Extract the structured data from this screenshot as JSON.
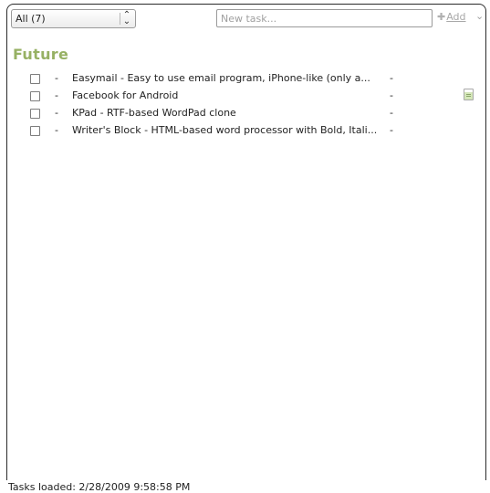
{
  "toolbar": {
    "filter_value": "All (7)",
    "filter_arrow_icon": "updown-arrows-icon",
    "new_task_placeholder": "New task...",
    "new_task_value": "",
    "add_label_prefix": "Add",
    "add_icon": "plus-icon",
    "menu_icon": "chevron-down-icon"
  },
  "section": {
    "title": "Future",
    "color": "#97b164"
  },
  "tasks": [
    {
      "checked": false,
      "dash": "-",
      "title": "Easymail - Easy to use email program, iPhone-like (only a...",
      "date": "-",
      "has_note": false
    },
    {
      "checked": false,
      "dash": "-",
      "title": "Facebook for Android",
      "date": "-",
      "has_note": true
    },
    {
      "checked": false,
      "dash": "-",
      "title": "KPad - RTF-based WordPad clone",
      "date": "-",
      "has_note": false
    },
    {
      "checked": false,
      "dash": "-",
      "title": "Writer's Block - HTML-based word processor with Bold, Itali...",
      "date": "-",
      "has_note": false
    }
  ],
  "status": {
    "text": "Tasks loaded: 2/28/2009 9:58:58 PM"
  }
}
